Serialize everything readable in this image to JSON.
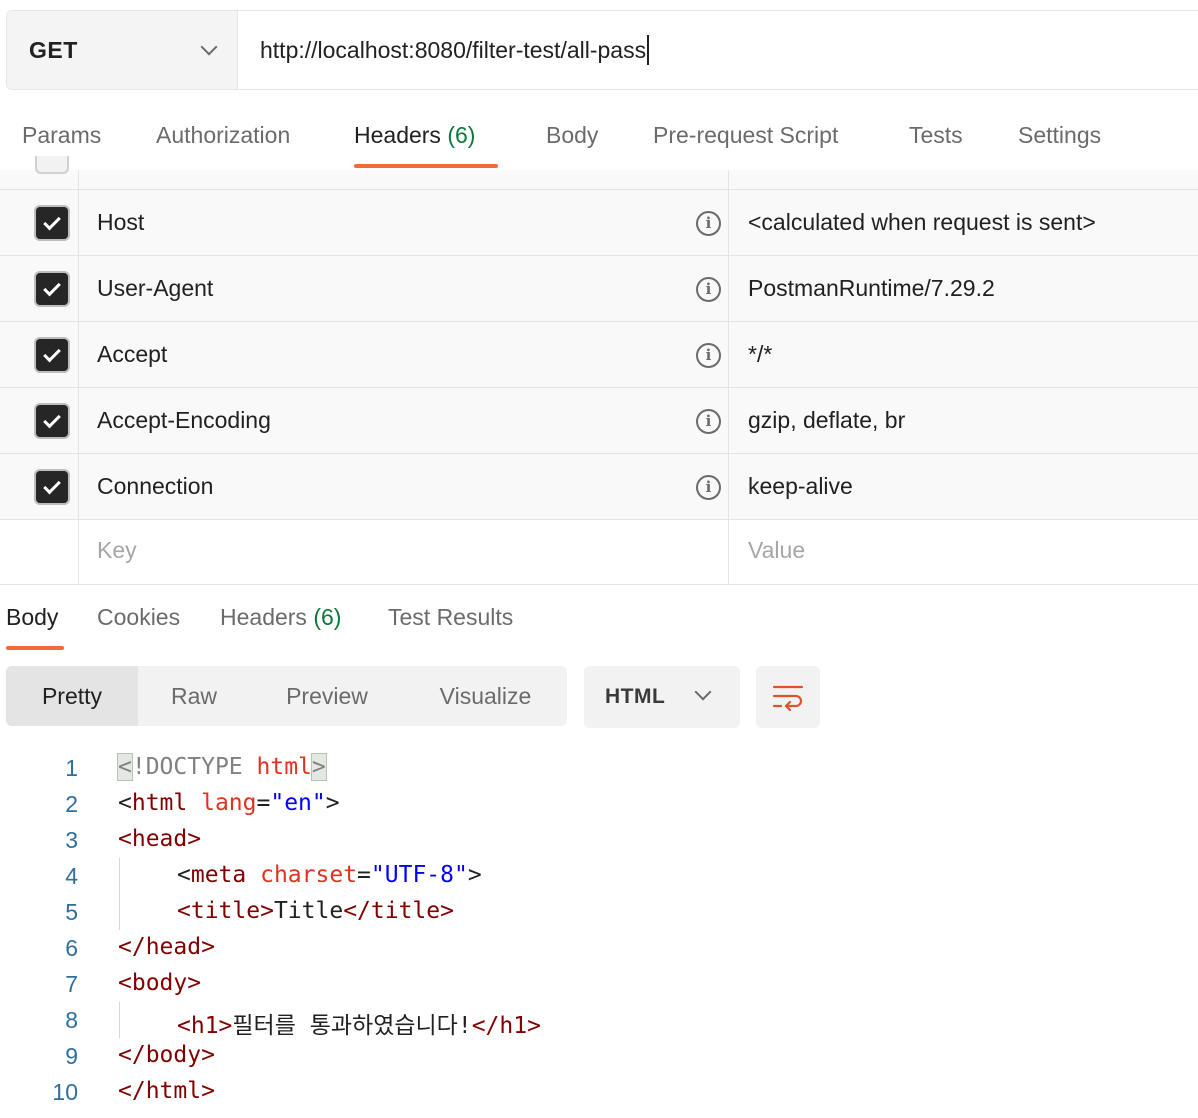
{
  "request": {
    "method": "GET",
    "url": "http://localhost:8080/filter-test/all-pass"
  },
  "request_tabs": [
    {
      "label": "Params"
    },
    {
      "label": "Authorization"
    },
    {
      "label": "Headers",
      "count": "(6)",
      "active": true
    },
    {
      "label": "Body"
    },
    {
      "label": "Pre-request Script"
    },
    {
      "label": "Tests"
    },
    {
      "label": "Settings"
    }
  ],
  "headers": [
    {
      "key": "Host",
      "value": "<calculated when request is sent>",
      "enabled": true
    },
    {
      "key": "User-Agent",
      "value": "PostmanRuntime/7.29.2",
      "enabled": true
    },
    {
      "key": "Accept",
      "value": "*/*",
      "enabled": true
    },
    {
      "key": "Accept-Encoding",
      "value": "gzip, deflate, br",
      "enabled": true
    },
    {
      "key": "Connection",
      "value": "keep-alive",
      "enabled": true
    }
  ],
  "new_header": {
    "key_placeholder": "Key",
    "value_placeholder": "Value"
  },
  "response_tabs": [
    {
      "label": "Body",
      "active": true
    },
    {
      "label": "Cookies"
    },
    {
      "label": "Headers",
      "count": "(6)"
    },
    {
      "label": "Test Results"
    }
  ],
  "view_modes": [
    "Pretty",
    "Raw",
    "Preview",
    "Visualize"
  ],
  "active_view": "Pretty",
  "format": "HTML",
  "icons": {
    "wrap": "wrap-lines-icon",
    "info": "info-icon",
    "check": "check-icon",
    "chevron": "chevron-down-icon"
  },
  "colors": {
    "accent": "#ef6c3a",
    "count": "#0d7a3c",
    "line_number": "#2f6f9e"
  },
  "code": {
    "line_numbers": [
      "1",
      "2",
      "3",
      "4",
      "5",
      "6",
      "7",
      "8",
      "9",
      "10"
    ],
    "l1": {
      "open": "<",
      "doctype": "!DOCTYPE",
      "name": "html",
      "close": ">"
    },
    "l2": {
      "open": "<",
      "tag": "html",
      "attr": "lang",
      "eq": "=",
      "val": "\"en\"",
      "close": ">"
    },
    "l3": {
      "text": "<head>"
    },
    "l4": {
      "open": "<",
      "tag": "meta",
      "attr": "charset",
      "eq": "=",
      "val": "\"UTF-8\"",
      "close": ">"
    },
    "l5": {
      "open_tag": "<title>",
      "text": "Title",
      "close_tag": "</title>"
    },
    "l6": {
      "text": "</head>"
    },
    "l7": {
      "text": "<body>"
    },
    "l8": {
      "open_tag": "<h1>",
      "text": "필터를 통과하였습니다!",
      "close_tag": "</h1>"
    },
    "l9": {
      "text": "</body>"
    },
    "l10": {
      "text": "</html>"
    }
  }
}
